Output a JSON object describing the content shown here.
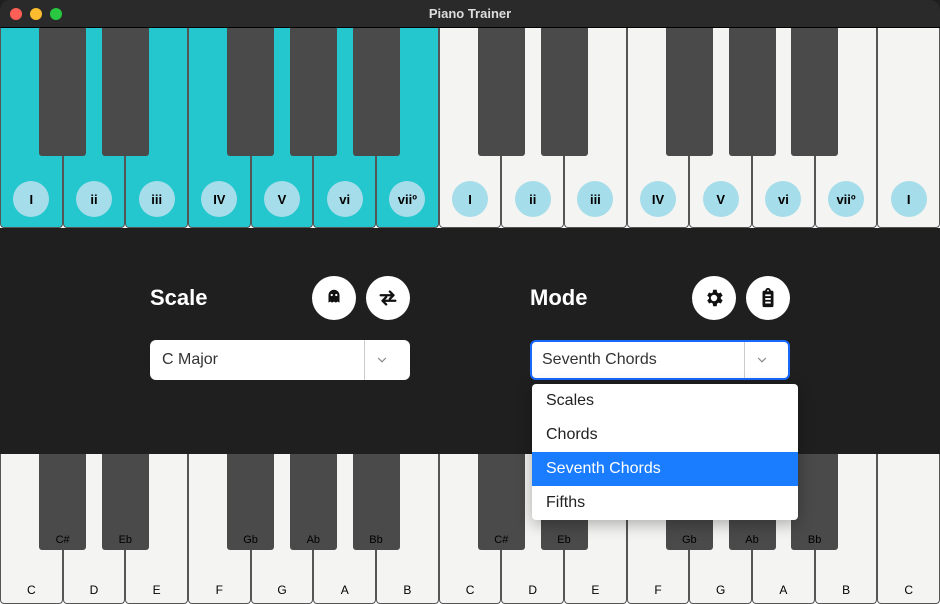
{
  "window": {
    "title": "Piano Trainer"
  },
  "traffic_colors": {
    "close": "#ff5f57",
    "min": "#febc2e",
    "max": "#28c840"
  },
  "top_keyboard": {
    "highlight_white_indices": [
      0,
      1,
      2,
      3,
      4,
      5,
      6
    ],
    "badges": [
      "I",
      "ii",
      "iii",
      "IV",
      "V",
      "vi",
      "viiº",
      "I",
      "ii",
      "iii",
      "IV",
      "V",
      "vi",
      "viiº",
      "I"
    ]
  },
  "bottom_keyboard": {
    "white_labels": [
      "C",
      "D",
      "E",
      "F",
      "G",
      "A",
      "B",
      "C",
      "D",
      "E",
      "F",
      "G",
      "A",
      "B",
      "C"
    ],
    "black_labels": [
      "C#",
      "Eb",
      "",
      "Gb",
      "Ab",
      "Bb",
      "",
      "C#",
      "Eb",
      "",
      "Gb",
      "Ab",
      "Bb",
      ""
    ]
  },
  "black_key_positions_pct": [
    4.16,
    10.83,
    24.16,
    30.83,
    37.5,
    50.83,
    57.5,
    70.83,
    77.5,
    84.16
  ],
  "controls": {
    "scale": {
      "label": "Scale",
      "value": "C Major"
    },
    "mode": {
      "label": "Mode",
      "value": "Seventh Chords",
      "options": [
        "Scales",
        "Chords",
        "Seventh Chords",
        "Fifths"
      ],
      "selected_index": 2
    }
  }
}
